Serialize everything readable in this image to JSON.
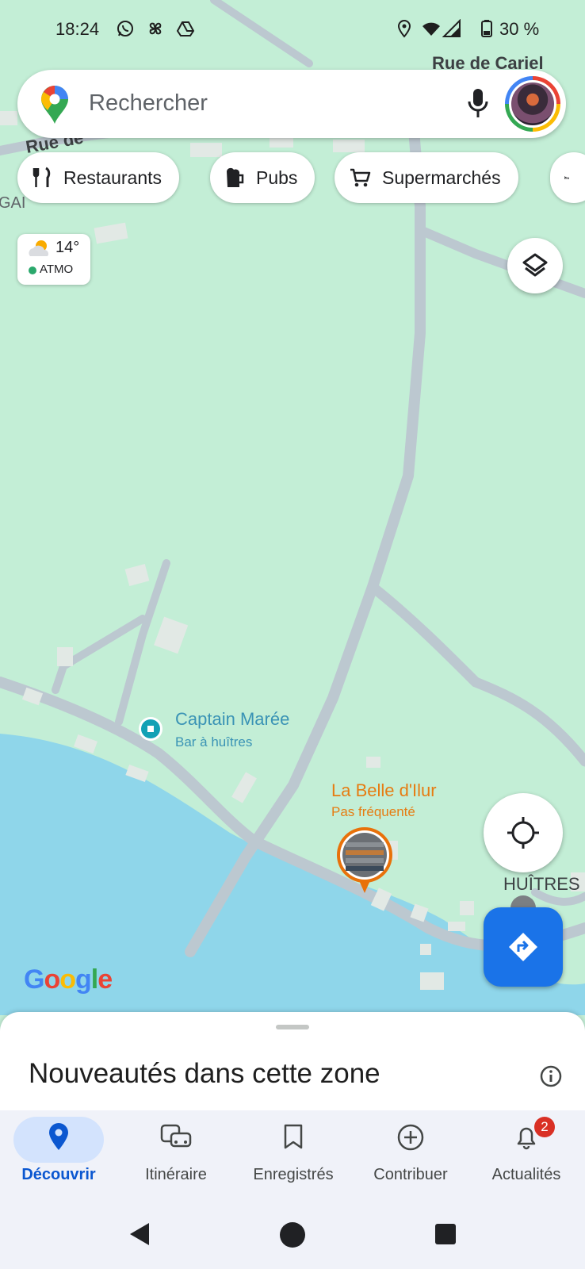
{
  "status_bar": {
    "time": "18:24",
    "battery": "30 %",
    "icons": [
      "whatsapp-icon",
      "pinwheel-icon",
      "drive-icon",
      "location-icon",
      "wifi-icon",
      "signal-icon",
      "battery-icon"
    ]
  },
  "search": {
    "placeholder": "Rechercher",
    "icons": [
      "maps-pin-logo",
      "mic-icon",
      "avatar"
    ]
  },
  "chips": [
    {
      "label": "Restaurants",
      "icon": "fork-knife-icon"
    },
    {
      "label": "Pubs",
      "icon": "beer-mug-icon"
    },
    {
      "label": "Supermarchés",
      "icon": "cart-icon"
    },
    {
      "label": "",
      "icon": "bed-icon"
    }
  ],
  "weather": {
    "temp": "14°",
    "air_quality": "ATMO",
    "icon": "partly-cloudy-icon"
  },
  "map": {
    "street_labels": {
      "rue_cariel": "Rue de Cariel",
      "rue_de": "Rue de",
      "partial_left": "GAI",
      "partial_right": "HUÎTRES P"
    },
    "pois": [
      {
        "name": "Captain Marée",
        "subtitle": "Bar à huîtres",
        "color": "#3a93b5"
      },
      {
        "name": "La Belle d'Ilur",
        "subtitle": "Pas fréquenté",
        "color": "#e67c12"
      }
    ],
    "attribution": "Google",
    "colors": {
      "land": "#c3eed6",
      "road": "#bcc8d0",
      "water": "#8fd6ea",
      "building": "#e2e9e5"
    }
  },
  "controls": {
    "layers_icon": "layers-icon",
    "locate_icon": "my-location-icon",
    "directions_icon": "directions-icon"
  },
  "sheet": {
    "title": "Nouveautés dans cette zone",
    "info_icon": "info-icon"
  },
  "nav": {
    "items": [
      {
        "label": "Découvrir",
        "icon": "explore-pin-icon",
        "active": true
      },
      {
        "label": "Itinéraire",
        "icon": "commute-icon"
      },
      {
        "label": "Enregistrés",
        "icon": "bookmark-icon"
      },
      {
        "label": "Contribuer",
        "icon": "add-circle-icon"
      },
      {
        "label": "Actualités",
        "icon": "bell-icon",
        "badge": "2"
      }
    ],
    "accent": "#0b57d0"
  },
  "system_nav": [
    "back-icon",
    "home-icon",
    "recents-icon"
  ]
}
